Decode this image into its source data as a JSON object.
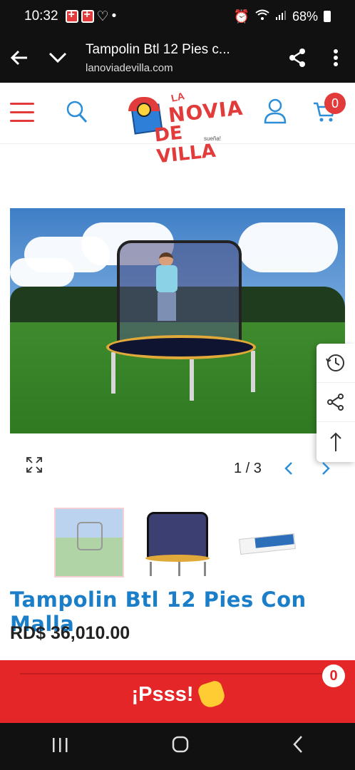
{
  "status_bar": {
    "time": "10:32",
    "dot": "•",
    "battery": "68%"
  },
  "browser": {
    "page_title": "Tampolin Btl 12 Pies c...",
    "url": "lanoviadevilla.com"
  },
  "site": {
    "logo_line1": "LA",
    "logo_line2": "NOVIA",
    "logo_line3": "DE VILLA",
    "logo_tagline": "sueña!",
    "cart_count": "0"
  },
  "gallery": {
    "counter": "1 / 3",
    "prev_label": "‹",
    "next_label": "›"
  },
  "product": {
    "title": "Tampolin Btl 12 Pies Con Malla",
    "price": "RD$ 36,010.00"
  },
  "promo": {
    "label": "¡Psss!",
    "badge": "0"
  },
  "icons": {
    "back": "back-arrow-icon",
    "dropdown": "chevron-down-icon",
    "share": "share-icon",
    "more": "more-vert-icon",
    "menu": "hamburger-menu-icon",
    "search": "search-icon",
    "user": "user-icon",
    "cart": "cart-icon",
    "zoom": "expand-icon",
    "history": "history-icon",
    "share_tool": "share-icon",
    "top": "arrow-up-icon"
  },
  "colors": {
    "brand_red": "#e23b3b",
    "brand_blue": "#1b7ec8",
    "promo_red": "#e52628"
  }
}
